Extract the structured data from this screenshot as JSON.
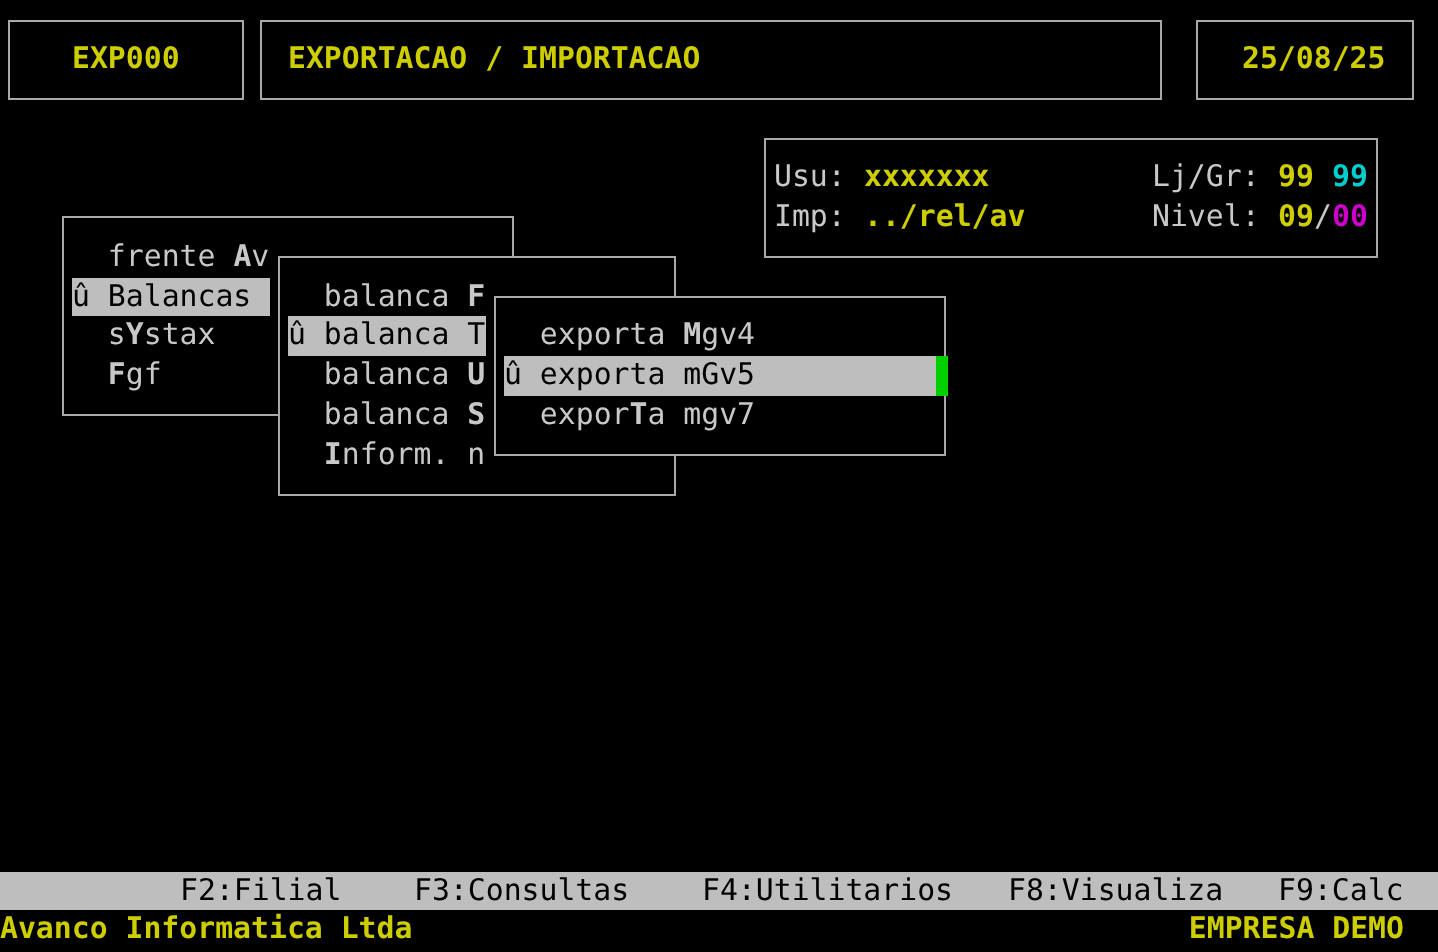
{
  "header": {
    "code": "EXP000",
    "title": "EXPORTACAO / IMPORTACAO",
    "date": "25/08/25"
  },
  "info": {
    "user_label": "Usu:",
    "user": "xxxxxxx",
    "store_label": "Lj/Gr:",
    "store": "99",
    "group": "99",
    "printer_label": "Imp:",
    "printer": "../rel/av",
    "level_label": "Nivel:",
    "level_a": "09",
    "level_sep": "/",
    "level_b": "00"
  },
  "menus": [
    {
      "items": [
        {
          "label": "frente **A**v",
          "selected": false
        },
        {
          "marker": "û",
          "label": "Balancas",
          "selected": true
        },
        {
          "label": "s**Y**stax",
          "selected": false
        },
        {
          "label": "**F**gf",
          "selected": false
        }
      ]
    },
    {
      "items": [
        {
          "label": "balanca **F**",
          "selected": false
        },
        {
          "marker": "û",
          "label": "balanca T",
          "selected": true
        },
        {
          "label": "balanca **U**",
          "selected": false
        },
        {
          "label": "balanca **S**",
          "selected": false
        },
        {
          "label": "**I**nform. n",
          "selected": false
        }
      ]
    },
    {
      "items": [
        {
          "label": "exporta **M**gv4",
          "selected": false
        },
        {
          "marker": "û",
          "label": "exporta mGv5",
          "selected": true
        },
        {
          "label": "expor**T**a mgv7",
          "selected": false
        }
      ]
    }
  ],
  "function_keys": [
    "F2:Filial",
    "F3:Consultas",
    "F4:Utilitarios",
    "F8:Visualiza",
    "F9:Calc"
  ],
  "status": {
    "company": "Avanco Informatica Ltda",
    "tenant": "EMPRESA DEMO"
  }
}
